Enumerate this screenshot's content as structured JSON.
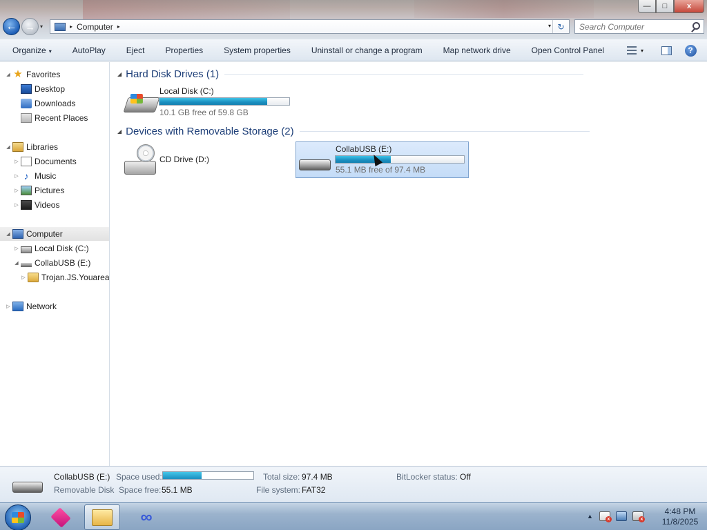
{
  "window": {
    "controls": {
      "minimize": "—",
      "maximize": "□",
      "close": "x"
    }
  },
  "navigation": {
    "back_glyph": "←",
    "forward_glyph": "→",
    "history_glyph": "▾",
    "address": {
      "crumb": "Computer",
      "separator": "▸",
      "dropdown_glyph": "▾",
      "refresh_glyph": "↻"
    },
    "search": {
      "placeholder": "Search Computer"
    }
  },
  "toolbar": {
    "organize": "Organize",
    "caret": "▾",
    "autoplay": "AutoPlay",
    "eject": "Eject",
    "properties": "Properties",
    "system_properties": "System properties",
    "uninstall": "Uninstall or change a program",
    "map_network_drive": "Map network drive",
    "open_control_panel": "Open Control Panel",
    "help_glyph": "?"
  },
  "sidebar": {
    "expand_glyph": "◢",
    "collapsed_glyph": "▷",
    "star_glyph": "★",
    "note_glyph": "♪",
    "favorites": {
      "label": "Favorites",
      "items": [
        "Desktop",
        "Downloads",
        "Recent Places"
      ]
    },
    "libraries": {
      "label": "Libraries",
      "items": [
        "Documents",
        "Music",
        "Pictures",
        "Videos"
      ]
    },
    "computer": {
      "label": "Computer",
      "items": [
        "Local Disk (C:)",
        "CollabUSB (E:)"
      ]
    },
    "usb_child": "Trojan.JS.Youarean",
    "network": "Network"
  },
  "main": {
    "group_glyph": "◢",
    "hard_disk_group": "Hard Disk Drives (1)",
    "removable_group": "Devices with Removable Storage (2)",
    "drives": {
      "local": {
        "name": "Local Disk (C:)",
        "free_text": "10.1 GB free of 59.8 GB",
        "used_fraction": 0.83
      },
      "cd": {
        "name": "CD Drive (D:)"
      },
      "usb": {
        "name": "CollabUSB (E:)",
        "free_text": "55.1 MB free of 97.4 MB",
        "used_fraction": 0.43,
        "selected": true
      }
    }
  },
  "details": {
    "name": "CollabUSB (E:)",
    "type": "Removable Disk",
    "space_used_label": "Space used:",
    "space_used_fraction": 0.43,
    "space_free_label": "Space free:",
    "space_free_value": "55.1 MB",
    "total_size_label": "Total size:",
    "total_size_value": "97.4 MB",
    "file_system_label": "File system:",
    "file_system_value": "FAT32",
    "bitlocker_label": "BitLocker status:",
    "bitlocker_value": "Off"
  },
  "taskbar": {
    "show_hidden_glyph": "▲",
    "x_glyph": "x",
    "time": "4:48 PM",
    "date": "11/8/2025",
    "loop_glyph": "∞"
  },
  "colors": {
    "bar_fill": "#1b8fc0",
    "selection_bg": "#cfe3f8",
    "group_title": "#1e3f78"
  }
}
